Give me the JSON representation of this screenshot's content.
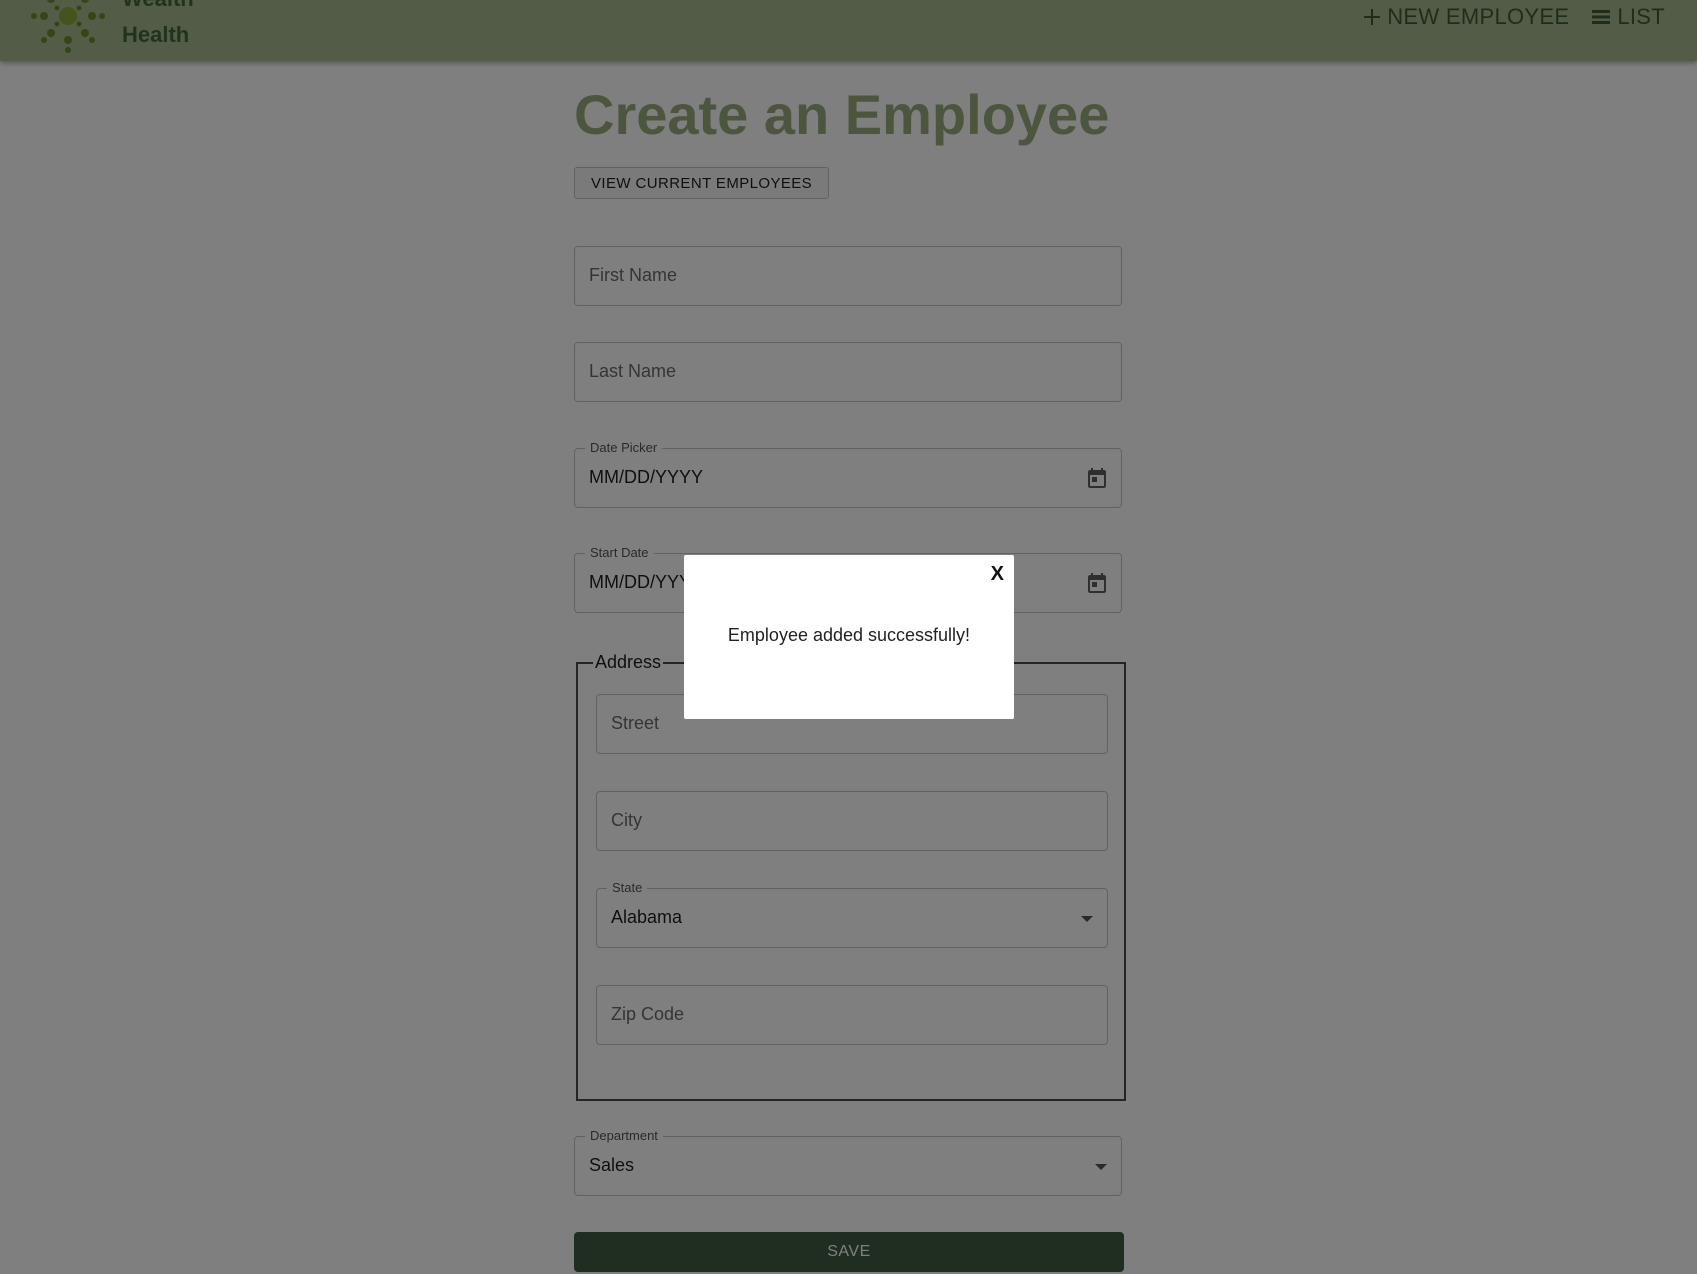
{
  "header": {
    "brand_line1": "Wealth",
    "brand_line2": "Health",
    "nav": [
      {
        "label": "NEW EMPLOYEE",
        "icon": "plus-icon"
      },
      {
        "label": "LIST",
        "icon": "list-icon"
      }
    ]
  },
  "page": {
    "title": "Create an Employee",
    "view_employees_label": "VIEW CURRENT EMPLOYEES"
  },
  "form": {
    "first_name": {
      "placeholder": "First Name",
      "value": ""
    },
    "last_name": {
      "placeholder": "Last Name",
      "value": ""
    },
    "date_of_birth": {
      "label": "Date Picker",
      "value": "MM/DD/YYYY",
      "icon": "calendar-icon"
    },
    "start_date": {
      "label": "Start Date",
      "value": "MM/DD/YYYY",
      "icon": "calendar-icon"
    },
    "address": {
      "legend": "Address",
      "street": {
        "placeholder": "Street",
        "value": ""
      },
      "city": {
        "placeholder": "City",
        "value": ""
      },
      "state": {
        "label": "State",
        "value": "Alabama"
      },
      "zip": {
        "placeholder": "Zip Code",
        "value": ""
      }
    },
    "department": {
      "label": "Department",
      "value": "Sales"
    },
    "save_label": "SAVE"
  },
  "modal": {
    "close_label": "X",
    "message": "Employee added successfully!"
  },
  "colors": {
    "header_bg": "#a5b98e",
    "brand_text": "#42663d",
    "title_text": "#98ad7e",
    "save_bg": "#3f5c43",
    "overlay": "rgba(0,0,0,0.5)"
  }
}
